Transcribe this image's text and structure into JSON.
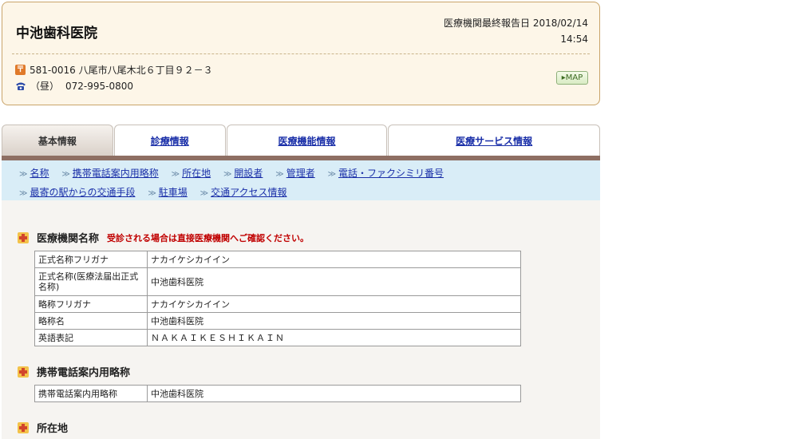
{
  "header": {
    "clinic_name": "中池歯科医院",
    "report_label": "医療機関最終報告日 2018/02/14",
    "report_time": "14:54",
    "postal_icon": "〒",
    "address": "581-0016 八尾市八尾木北６丁目９２－３",
    "tel_label": "（昼）",
    "tel": "072-995-0800",
    "map_label": "▸MAP"
  },
  "tabs": [
    {
      "label": "基本情報",
      "active": true
    },
    {
      "label": "診療情報",
      "active": false
    },
    {
      "label": "医療機能情報",
      "active": false
    },
    {
      "label": "医療サービス情報",
      "active": false
    }
  ],
  "anchors": [
    "名称",
    "携帯電話案内用略称",
    "所在地",
    "開設者",
    "管理者",
    "電話・ファクシミリ番号",
    "最寄の駅からの交通手段",
    "駐車場",
    "交通アクセス情報"
  ],
  "sections": {
    "name": {
      "title": "医療機関名称",
      "notice": "受診される場合は直接医療機関へご確認ください。",
      "rows": [
        {
          "key": "正式名称フリガナ",
          "value": "ナカイケシカイイン"
        },
        {
          "key": "正式名称(医療法届出正式名称)",
          "value": "中池歯科医院"
        },
        {
          "key": "略称フリガナ",
          "value": "ナカイケシカイイン"
        },
        {
          "key": "略称名",
          "value": "中池歯科医院"
        },
        {
          "key": "英語表記",
          "value": "ＮＡＫＡＩＫＥＳＨＩＫＡＩＮ"
        }
      ]
    },
    "mobile": {
      "title": "携帯電話案内用略称",
      "rows": [
        {
          "key": "携帯電話案内用略称",
          "value": "中池歯科医院"
        }
      ]
    },
    "location": {
      "title": "所在地"
    }
  },
  "colors": {
    "header_bg": "#fdf6e8",
    "tab_bar": "#8e6f63",
    "nav_bg": "#d9edf7",
    "link": "#1a2fa8",
    "notice": "#c00000"
  }
}
